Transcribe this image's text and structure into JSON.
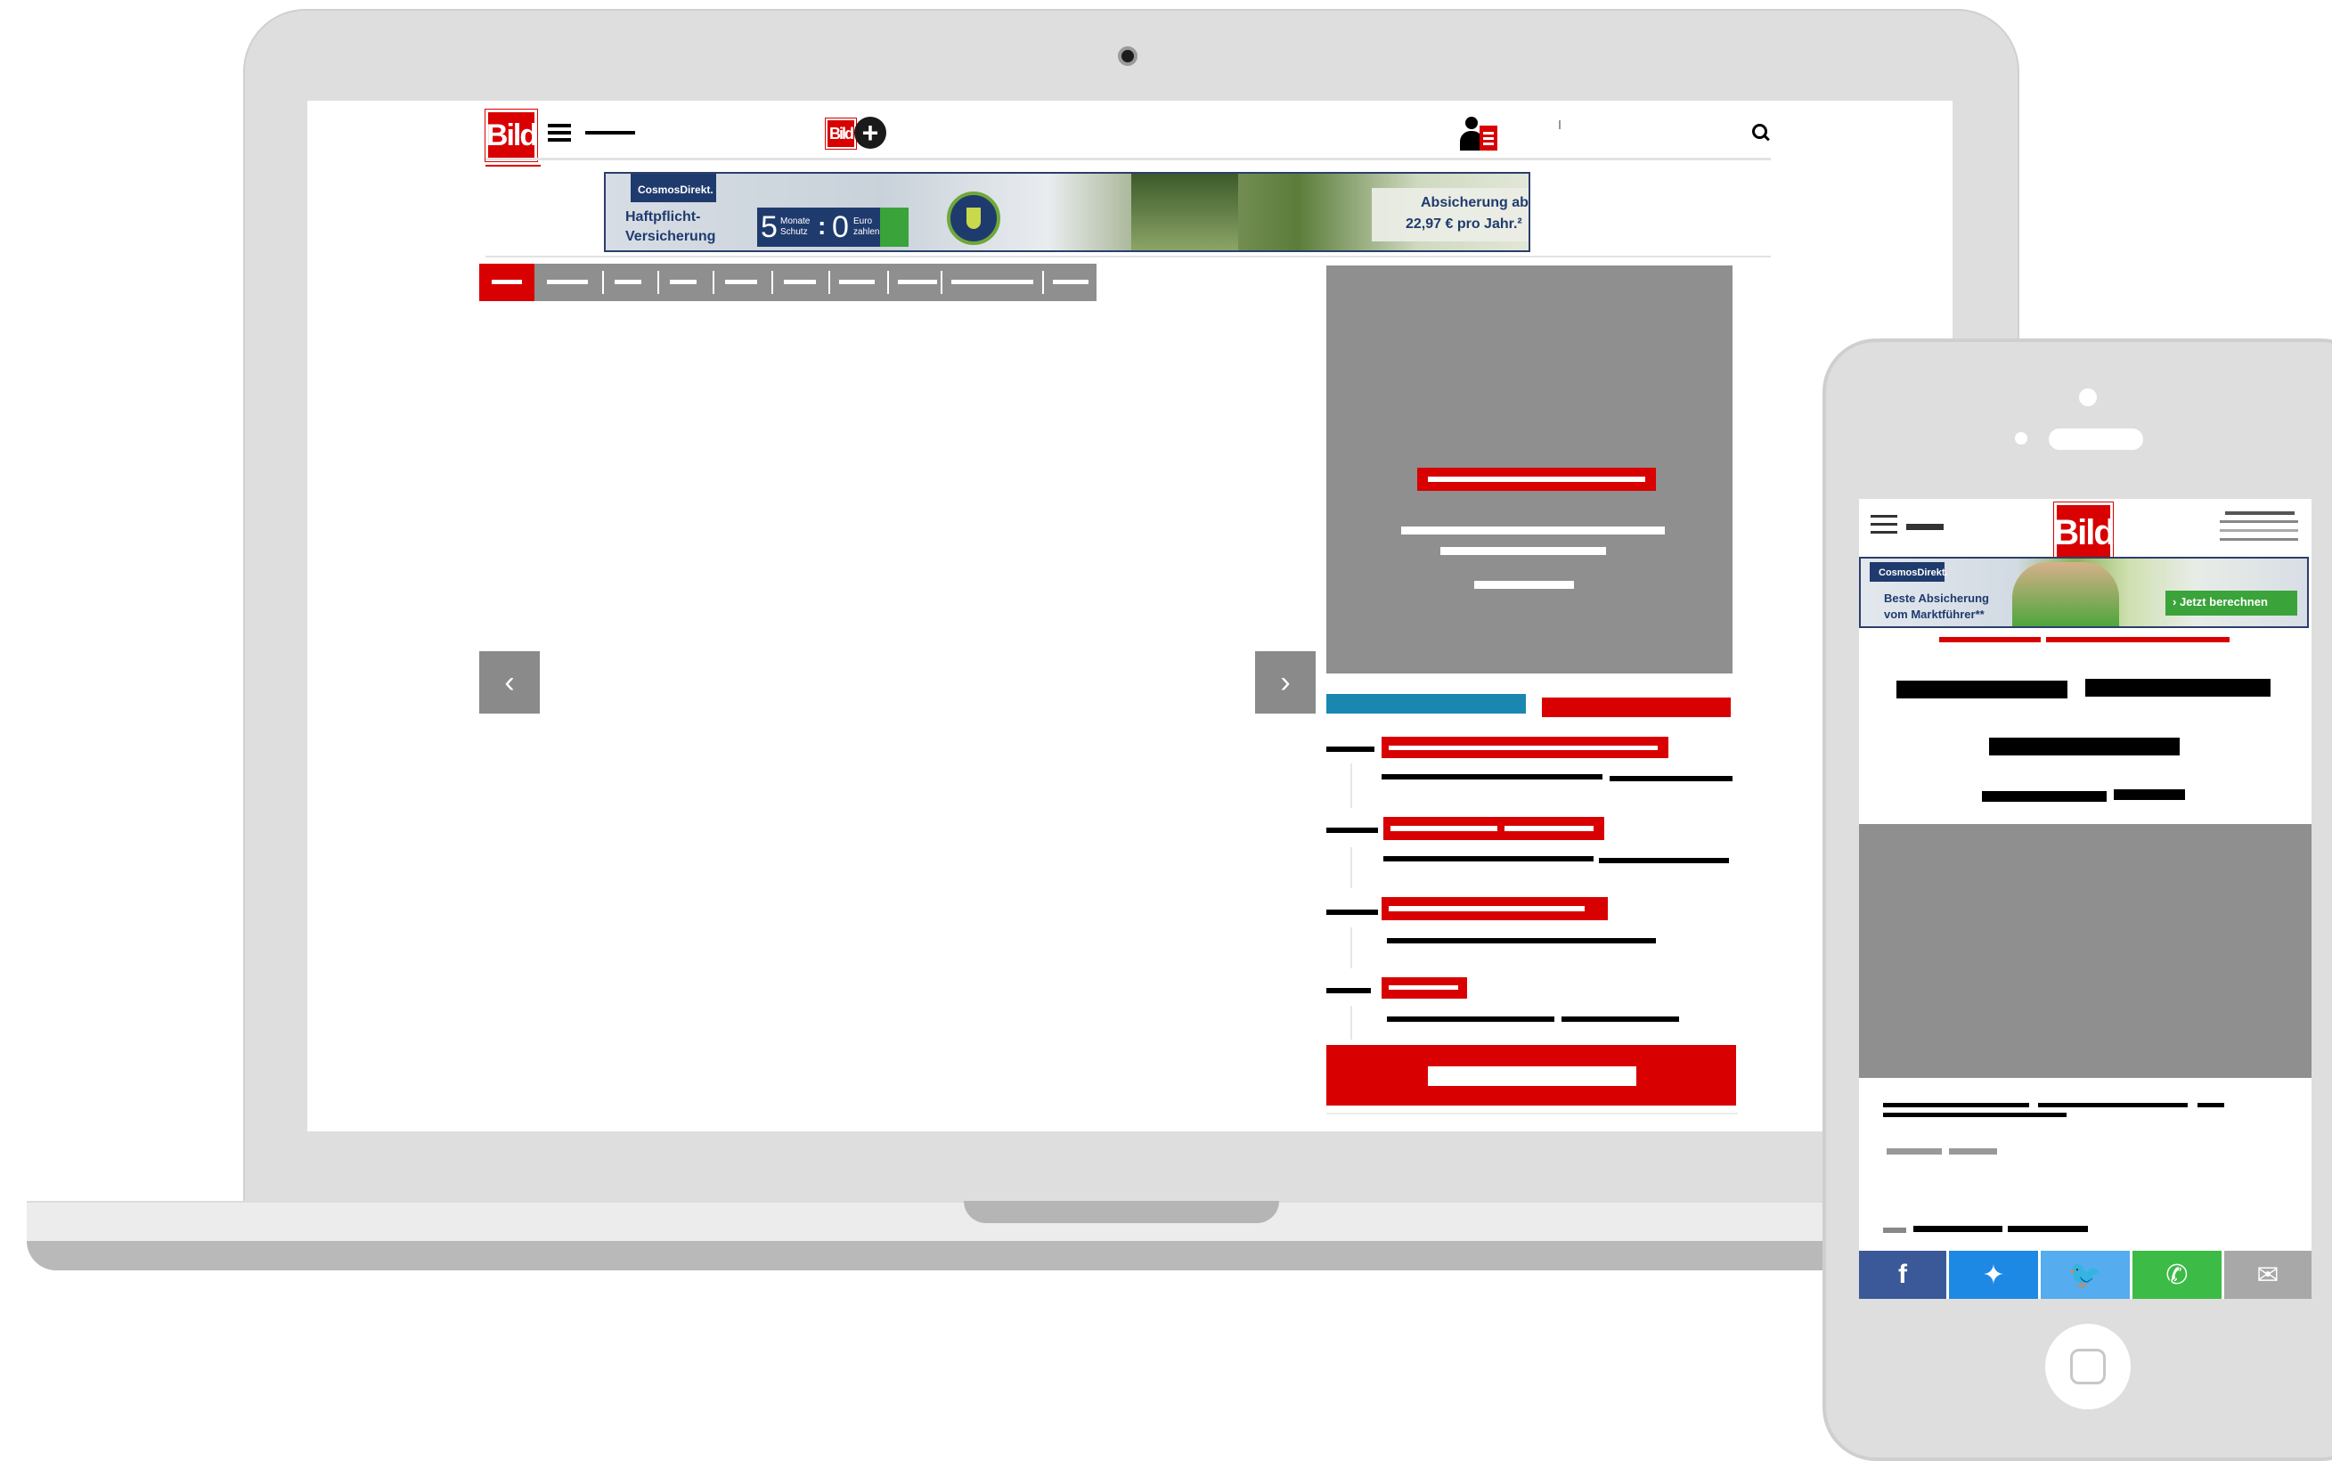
{
  "desktop": {
    "logo_text": "Bild",
    "bildplus_text": "Bild",
    "ad": {
      "brand": "CosmosDirekt.",
      "product_line1": "Haftpflicht-",
      "product_line2": "Versicherung",
      "months_number": "5",
      "months_label_line1": "Monate",
      "months_label_line2": "Schutz",
      "colon": ":",
      "zero": "0",
      "euro_line1": "Euro",
      "euro_line2": "zahlen",
      "price_line1": "Absicherung ab",
      "price_line2": "22,97 € pro Jahr.²"
    },
    "arrow_prev": "‹",
    "arrow_next": "›"
  },
  "mobile": {
    "logo_text": "Bild",
    "ad": {
      "brand": "CosmosDirekt.",
      "line1": "Beste Absicherung",
      "line2": "vom Marktführer**",
      "cta": "› Jetzt berechnen"
    },
    "share": {
      "facebook": "f",
      "messenger": "✦",
      "twitter": "🐦",
      "whatsapp": "✆",
      "email": "✉"
    }
  },
  "colors": {
    "brand_red": "#d80000",
    "placeholder_grey": "#8f8f8f",
    "teal_bar": "#1a87b0",
    "facebook": "#3b5998",
    "messenger": "#1e88e5",
    "twitter": "#55acee",
    "whatsapp": "#3cbb46",
    "email": "#a8a8a8"
  }
}
